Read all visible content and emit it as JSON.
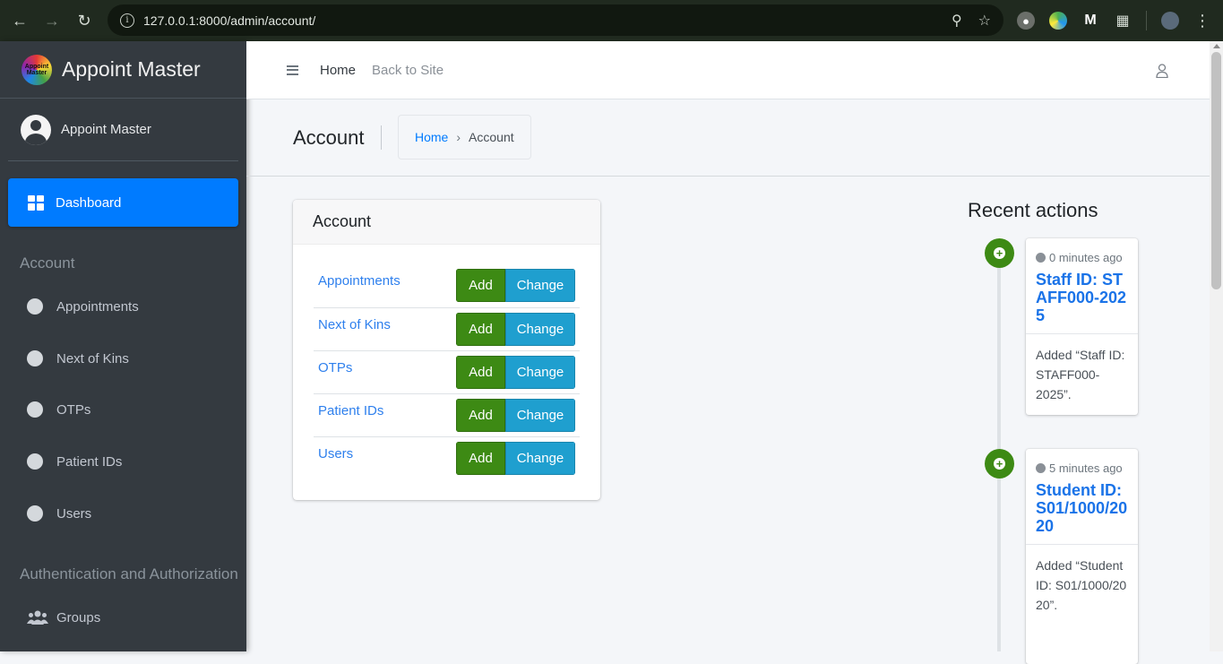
{
  "browser": {
    "url": "127.0.0.1:8000/admin/account/"
  },
  "sidebar": {
    "brand": "Appoint Master",
    "brand_logo_text": "Appoint Master",
    "user": "Appoint Master",
    "dashboard": "Dashboard",
    "sections": [
      {
        "header": "Account",
        "items": [
          "Appointments",
          "Next of Kins",
          "OTPs",
          "Patient IDs",
          "Users"
        ]
      },
      {
        "header": "Authentication and Authorization",
        "items": [
          "Groups"
        ]
      }
    ]
  },
  "topbar": {
    "home": "Home",
    "back_to_site": "Back to Site"
  },
  "header": {
    "title": "Account",
    "breadcrumb": [
      "Home",
      "Account"
    ]
  },
  "app_card": {
    "title": "Account",
    "add_label": "Add",
    "change_label": "Change",
    "models": [
      "Appointments",
      "Next of Kins",
      "OTPs",
      "Patient IDs",
      "Users"
    ]
  },
  "recent": {
    "title": "Recent actions",
    "items": [
      {
        "time": "0 minutes ago",
        "object": "Staff ID: STAFF000-2025",
        "message": "Added “Staff ID: STAFF000-2025”."
      },
      {
        "time": "5 minutes ago",
        "object": "Student ID: S01/1000/2020",
        "message": "Added “Student ID: S01/1000/2020”."
      }
    ]
  },
  "colors": {
    "sidebar_bg": "#343a40",
    "primary": "#007bff",
    "success": "#3d8a14",
    "info": "#1f9fcf"
  }
}
